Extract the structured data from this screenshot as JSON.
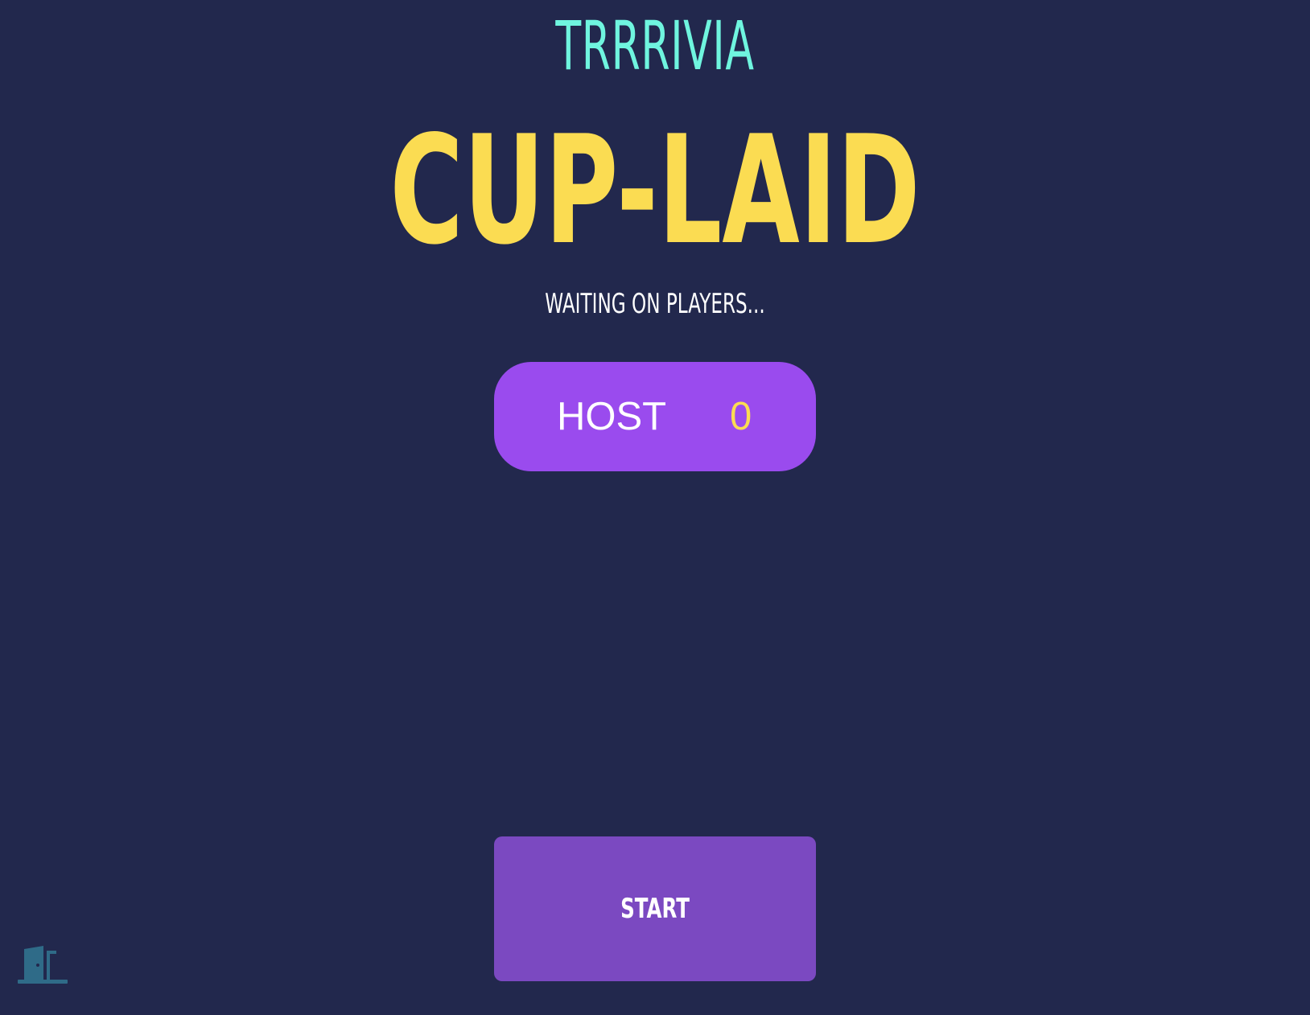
{
  "app": {
    "brand": "TRRRIVIA"
  },
  "room": {
    "code": "CUP-LAID",
    "status": "WAITING ON PLAYERS..."
  },
  "players": [
    {
      "name": "HOST",
      "score": "0"
    }
  ],
  "actions": {
    "start_label": "START",
    "exit_icon": "exit-door-icon"
  },
  "colors": {
    "background": "#22284d",
    "brand": "#6ff5df",
    "room_code": "#fbdc52",
    "player_pill": "#9a4bee",
    "score": "#fbdc52",
    "start_button": "#7b49c1",
    "exit_icon": "#2f6b88"
  }
}
